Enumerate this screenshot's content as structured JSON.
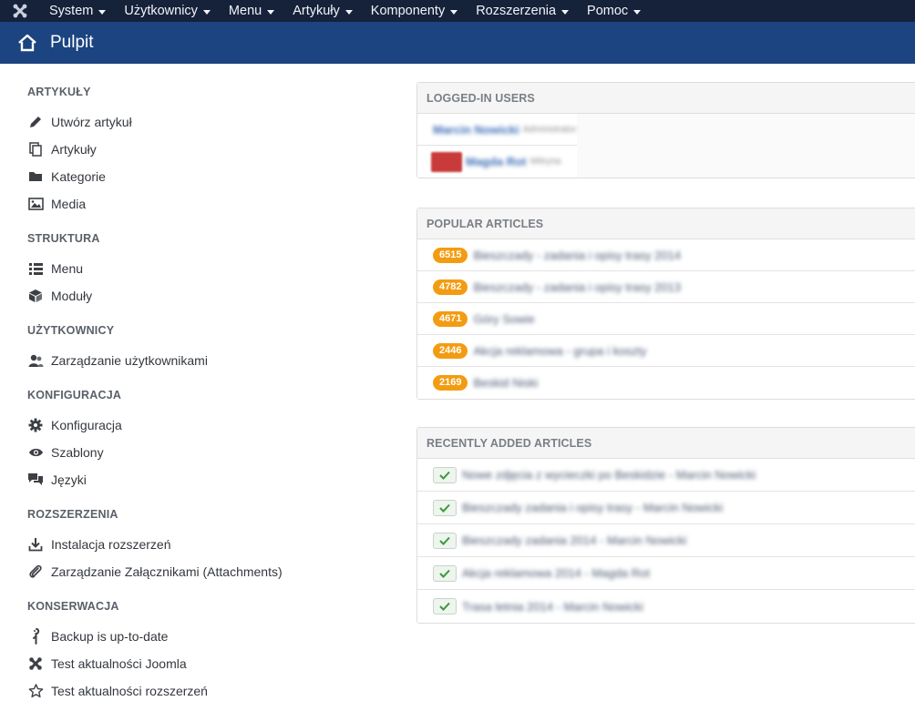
{
  "topbar": {
    "items": [
      {
        "label": "System"
      },
      {
        "label": "Użytkownicy"
      },
      {
        "label": "Menu"
      },
      {
        "label": "Artykuły"
      },
      {
        "label": "Komponenty"
      },
      {
        "label": "Rozszerzenia"
      },
      {
        "label": "Pomoc"
      }
    ]
  },
  "header": {
    "title": "Pulpit"
  },
  "sidebar": {
    "sections": [
      {
        "title": "ARTYKUŁY",
        "items": [
          {
            "label": "Utwórz artykuł",
            "icon": "pencil-icon"
          },
          {
            "label": "Artykuły",
            "icon": "copy-icon"
          },
          {
            "label": "Kategorie",
            "icon": "folder-icon"
          },
          {
            "label": "Media",
            "icon": "image-icon"
          }
        ]
      },
      {
        "title": "STRUKTURA",
        "items": [
          {
            "label": "Menu",
            "icon": "list-icon"
          },
          {
            "label": "Moduły",
            "icon": "cube-icon"
          }
        ]
      },
      {
        "title": "UŻYTKOWNICY",
        "items": [
          {
            "label": "Zarządzanie użytkownikami",
            "icon": "users-icon"
          }
        ]
      },
      {
        "title": "KONFIGURACJA",
        "items": [
          {
            "label": "Konfiguracja",
            "icon": "gear-icon"
          },
          {
            "label": "Szablony",
            "icon": "eye-icon"
          },
          {
            "label": "Języki",
            "icon": "comments-icon"
          }
        ]
      },
      {
        "title": "ROZSZERZENIA",
        "items": [
          {
            "label": "Instalacja rozszerzeń",
            "icon": "download-icon"
          },
          {
            "label": "Zarządzanie Załącznikami (Attachments)",
            "icon": "paperclip-icon"
          }
        ]
      },
      {
        "title": "KONSERWACJA",
        "items": [
          {
            "label": "Backup is up-to-date",
            "icon": "akeeba-icon"
          },
          {
            "label": "Test aktualności Joomla",
            "icon": "joomla-icon"
          },
          {
            "label": "Test aktualności rozszerzeń",
            "icon": "star-icon"
          }
        ]
      }
    ]
  },
  "logged_in": {
    "title": "LOGGED-IN USERS",
    "users": [
      {
        "name": "Marcin Nowicki",
        "role": "Administrator"
      },
      {
        "name": "Magda Rot",
        "role": "Witryna"
      }
    ]
  },
  "popular": {
    "title": "POPULAR ARTICLES",
    "rows": [
      {
        "hits": "6515",
        "title": "Bieszczady - zadania i opisy trasy 2014"
      },
      {
        "hits": "4782",
        "title": "Bieszczady - zadania i opisy trasy 2013"
      },
      {
        "hits": "4671",
        "title": "Góry Sowie"
      },
      {
        "hits": "2446",
        "title": "Akcja reklamowa - grupa i koszty"
      },
      {
        "hits": "2169",
        "title": "Beskid Niski"
      }
    ]
  },
  "recent": {
    "title": "RECENTLY ADDED ARTICLES",
    "rows": [
      {
        "title": "Nowe zdjęcia z wycieczki po Beskidzie - Marcin Nowicki"
      },
      {
        "title": "Bieszczady zadania i opisy trasy - Marcin Nowicki"
      },
      {
        "title": "Bieszczady zadania 2014 - Marcin Nowicki"
      },
      {
        "title": "Akcja reklamowa 2014 - Magda Rot"
      },
      {
        "title": "Trasa letnia 2014 - Marcin Nowicki"
      }
    ]
  }
}
